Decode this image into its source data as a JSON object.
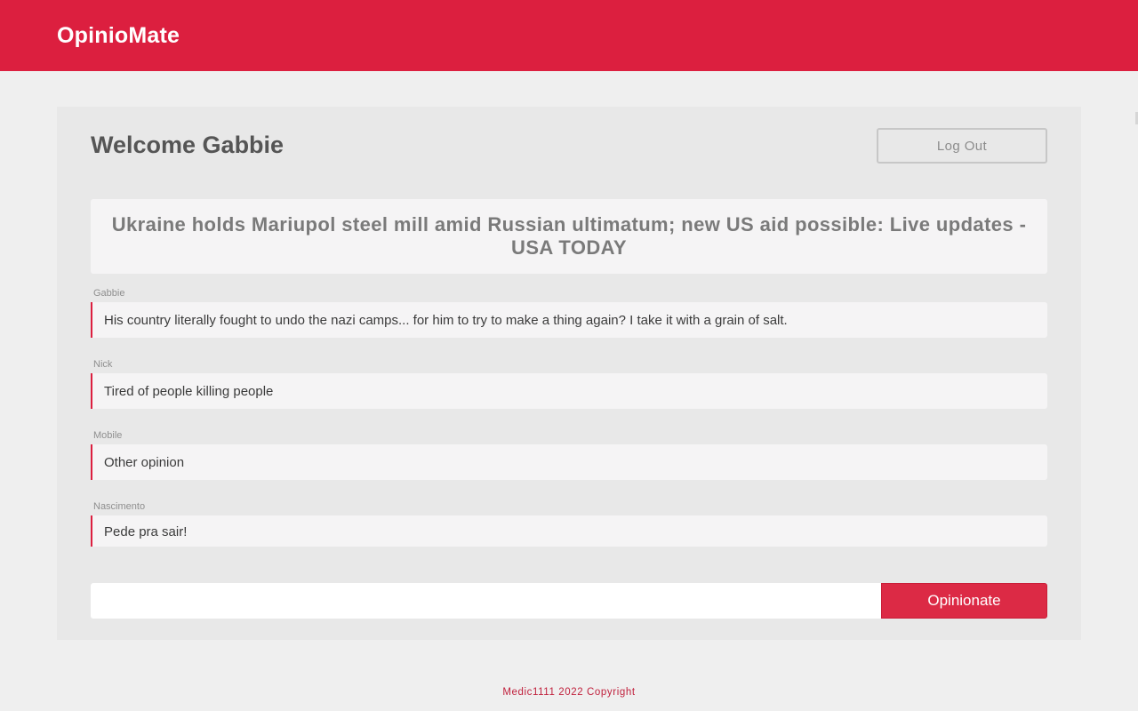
{
  "header": {
    "brand": "OpinioMate"
  },
  "panel": {
    "welcome": "Welcome Gabbie",
    "logout_label": "Log Out",
    "headline": "Ukraine holds Mariupol steel mill amid Russian ultimatum; new US aid possible: Live updates - USA TODAY"
  },
  "comments": [
    {
      "author": "Gabbie",
      "text": "His country literally fought to undo the nazi camps... for him to try to make a thing again? I take it with a grain of salt."
    },
    {
      "author": "Nick",
      "text": "Tired of people killing people"
    },
    {
      "author": "Mobile",
      "text": "Other opinion"
    },
    {
      "author": "Nascimento",
      "text": "Pede pra sair!"
    }
  ],
  "composer": {
    "input_value": "",
    "button_label": "Opinionate"
  },
  "footer": {
    "text": "Medic1111 2022 Copyright"
  },
  "colors": {
    "brand_red": "#dc1f3f",
    "button_red": "#dc2a45",
    "page_bg": "#efefef",
    "panel_bg": "#e8e8e8"
  }
}
